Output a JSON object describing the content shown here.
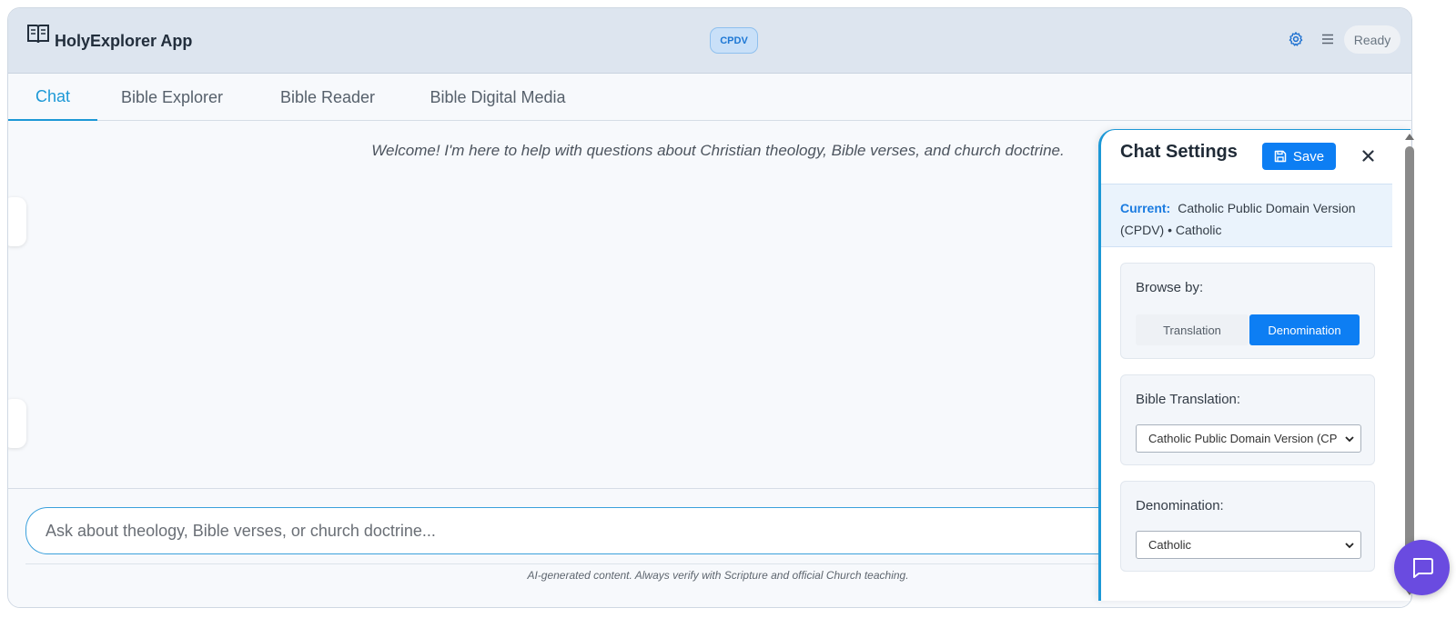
{
  "header": {
    "app_title": "HolyExplorer App",
    "version_badge": "CPDV",
    "status": "Ready",
    "logo_icon": "open-book-icon",
    "settings_icon": "gear-icon",
    "menu_icon": "hamburger-menu-icon"
  },
  "tabs": [
    {
      "label": "Chat",
      "active": true
    },
    {
      "label": "Bible Explorer",
      "active": false
    },
    {
      "label": "Bible Reader",
      "active": false
    },
    {
      "label": "Bible Digital Media",
      "active": false
    }
  ],
  "chat": {
    "welcome": "Welcome! I'm here to help with questions about Christian theology, Bible verses, and church doctrine.",
    "input_placeholder": "Ask about theology, Bible verses, or church doctrine...",
    "input_value": "",
    "disclaimer": "AI-generated content. Always verify with Scripture and official Church teaching."
  },
  "settings_panel": {
    "title": "Chat Settings",
    "save_label": "Save",
    "save_icon": "floppy-disk-icon",
    "close_icon": "close-icon",
    "current_label": "Current:",
    "current_value": "Catholic Public Domain Version (CPDV) • Catholic",
    "browse_label": "Browse by:",
    "browse_options": [
      "Translation",
      "Denomination"
    ],
    "browse_selected": "Denomination",
    "translation_label": "Bible Translation:",
    "translation_value": "Catholic Public Domain Version (CP",
    "denomination_label": "Denomination:",
    "denomination_value": "Catholic"
  },
  "fab": {
    "icon": "chat-bubble-icon"
  },
  "colors": {
    "accent": "#1c98d6",
    "primary_button": "#0d7ef3",
    "fab": "#6a4be0",
    "header_bg": "#dde5ef"
  }
}
